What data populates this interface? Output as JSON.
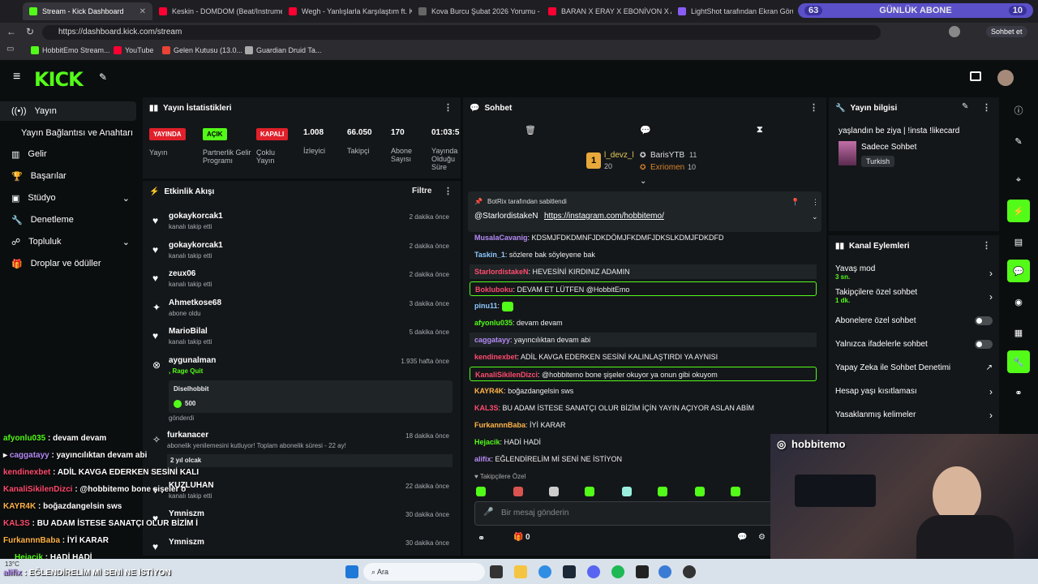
{
  "browser": {
    "tabs": [
      {
        "label": "Stream - Kick Dashboard",
        "color": "#53fc18"
      },
      {
        "label": "Keskin - DOMDOM (Beat/Instrume",
        "color": "#ff0033"
      },
      {
        "label": "Wegh - Yanlışlarla Karşılaştım ft. K",
        "color": "#ff0033"
      },
      {
        "label": "Kova Burcu Şubat 2026 Yorumu - ",
        "color": "#666666"
      },
      {
        "label": "BARAN X ERAY X EBONİVON X AY",
        "color": "#ff0033"
      },
      {
        "label": "LightShot tarafından Ekran Görün",
        "color": "#8a5cf6"
      }
    ],
    "url": "https://dashboard.kick.com/stream",
    "sub_counter": {
      "left": "63",
      "label": "GÜNLÜK ABONE",
      "right": "10"
    },
    "copilot": "Sohbet et",
    "bookmarks": [
      "HobbitEmo Stream...",
      "YouTube",
      "Gelen Kutusu (13.0...",
      "Guardian Druid Ta..."
    ]
  },
  "logo": "KICK",
  "sidebar": [
    {
      "label": "Yayın",
      "icon": "broadcast-icon"
    },
    {
      "label": "Yayın Bağlantısı ve Anahtarı",
      "icon": "none"
    },
    {
      "label": "Gelir",
      "icon": "chart-icon"
    },
    {
      "label": "Başarılar",
      "icon": "trophy-icon"
    },
    {
      "label": "Stüdyo",
      "icon": "studio-icon"
    },
    {
      "label": "Denetleme",
      "icon": "wrench-icon"
    },
    {
      "label": "Topluluk",
      "icon": "community-icon"
    },
    {
      "label": "Droplar ve ödüller",
      "icon": "gift-icon"
    }
  ],
  "stats": {
    "title": "Yayın İstatistikleri",
    "items": [
      {
        "badge": "YAYINDA",
        "badge_color": "#e0202a",
        "label": "Yayın"
      },
      {
        "badge": "AÇIK",
        "badge_color": "#53fc18",
        "label": "Partnerlik Gelir Programı"
      },
      {
        "badge": "KAPALI",
        "badge_color": "#e0202a",
        "label": "Çoklu Yayın"
      },
      {
        "value": "1.008",
        "label": "İzleyici"
      },
      {
        "value": "66.050",
        "label": "Takipçi"
      },
      {
        "value": "170",
        "label": "Abone Sayısı"
      },
      {
        "value": "01:03:5",
        "label": "Yayında Olduğu Süre"
      }
    ]
  },
  "activity": {
    "title": "Etkinlik Akışı",
    "filter": "Filtre",
    "items": [
      {
        "name": "gokaykorcak1",
        "desc": "kanalı takip etti",
        "time": "2 dakika önce"
      },
      {
        "name": "gokaykorcak1",
        "desc": "kanalı takip etti",
        "time": "2 dakika önce"
      },
      {
        "name": "zeux06",
        "desc": "kanalı takip etti",
        "time": "2 dakika önce"
      },
      {
        "name": "Ahmetkose68",
        "desc": "abone oldu",
        "time": "3 dakika önce"
      },
      {
        "name": "MarioBilal",
        "desc": "kanalı takip etti",
        "time": "5 dakika önce"
      },
      {
        "name": "aygunalman",
        "desc": ", Rage Quit",
        "time": "1.935 hafta önce"
      }
    ],
    "gift": {
      "user": "Diselhobbit",
      "amount": "500",
      "sent": "gönderdi"
    },
    "item7": {
      "name": "furkanacer",
      "desc": "abonelik yenilemesini kutluyor! Toplam abonelik süresi - 22 ay!",
      "note": "2 yıl olcak",
      "time": "18 dakika önce"
    },
    "item8": {
      "name": "KUZLUHAN",
      "desc": "kanalı takip etti",
      "time": "22 dakika önce"
    },
    "item9": {
      "name": "Ymniszm",
      "time": "30 dakika önce"
    },
    "item10": {
      "name": "Ymniszm",
      "time": "30 dakika önce"
    }
  },
  "chat": {
    "title": "Sohbet",
    "top": [
      {
        "name": "l_devz_l",
        "count": "20"
      },
      {
        "name": "BarisYTB",
        "count": "11"
      },
      {
        "name": "Exriomen",
        "count": "10"
      }
    ],
    "top_rank": "1",
    "pinned_by": "BotRix tarafından sabitlendi",
    "pinned_text": "@StarlordistakeN",
    "pinned_link": "https://instagram.com/hobbitemo/",
    "messages": [
      {
        "user": "MusalaCavanig",
        "color": "#b48af5",
        "text": "KDSMJFDKDMNFJDKDÖMJFKDMFJDKSLKDMJFDKDFD",
        "style": ""
      },
      {
        "user": "Taskin_1",
        "color": "#8ec9ff",
        "text": "sözlere bak söyleyene bak",
        "style": ""
      },
      {
        "user": "StarlordistakeN",
        "color": "#ff4b6e",
        "text": "HEVESİNİ KIRDINIZ ADAMIN",
        "style": "pur"
      },
      {
        "user": "Bokluboku",
        "color": "#ff4b6e",
        "text": "DEVAM ET LÜTFEN @HobbitEmo",
        "style": "hl"
      },
      {
        "user": "pinu11",
        "color": "#8ec9ff",
        "text": "",
        "style": ""
      },
      {
        "user": "afyonlu035",
        "color": "#53fc18",
        "text": "devam devam",
        "style": ""
      },
      {
        "user": "caggatayy",
        "color": "#b48af5",
        "text": "yayıncılıktan devam abi",
        "style": "pur"
      },
      {
        "user": "kendinexbet",
        "color": "#ff4b6e",
        "text": "ADİL KAVGA EDERKEN SESİNİ KALINLAŞTIRDI YA AYNISI",
        "style": ""
      },
      {
        "user": "KanaliSikilenDizci",
        "color": "#ff4b6e",
        "text": "@hobbitemo bone şişeler okuyor ya onun gibi okuyom",
        "style": "hl"
      },
      {
        "user": "KAYR4K",
        "color": "#ffb347",
        "text": "boğazdangelsin sws",
        "style": ""
      },
      {
        "user": "KAL3S",
        "color": "#ff4b6e",
        "text": "BU ADAM İSTESE SANATÇI OLUR BİZİM İÇİN YAYIN AÇIYOR ASLAN ABİM",
        "style": ""
      },
      {
        "user": "FurkannnBaba",
        "color": "#ffb347",
        "text": "İYİ KARAR",
        "style": ""
      },
      {
        "user": "Hejacik",
        "color": "#53fc18",
        "text": "HADİ HADİ",
        "style": ""
      },
      {
        "user": "alifix",
        "color": "#b48af5",
        "text": "EĞLENDİRELİM Mİ SENİ NE İSTİYON",
        "style": ""
      }
    ],
    "followers_label": "Takipçilere Özel",
    "placeholder": "Bir mesaj gönderin",
    "count": "0"
  },
  "info": {
    "title": "Yayın bilgisi",
    "stream_title": "yaşlandın be ziya | !insta !likecard",
    "category": "Sadece Sohbet",
    "language": "Turkish"
  },
  "actions": {
    "title": "Kanal Eylemleri",
    "items": [
      {
        "label": "Yavaş mod",
        "sub": "3 sn.",
        "control": "chevron"
      },
      {
        "label": "Takipçilere özel sohbet",
        "sub": "1 dk.",
        "control": "chevron"
      },
      {
        "label": "Abonelere özel sohbet",
        "sub": "",
        "control": "toggle"
      },
      {
        "label": "Yalnızca ifadelerle sohbet",
        "sub": "",
        "control": "toggle"
      },
      {
        "label": "Yapay Zeka ile Sohbet Denetimi",
        "sub": "",
        "control": "external"
      },
      {
        "label": "Hesap yaşı kısıtlaması",
        "sub": "",
        "control": "chevron"
      },
      {
        "label": "Yasaklanmış kelimeler",
        "sub": "",
        "control": "chevron"
      }
    ]
  },
  "overlay": {
    "cam_name": "hobbitemo",
    "lines": [
      {
        "user": "afyonlu035",
        "text": "devam devam",
        "color": "#53fc18"
      },
      {
        "user": "caggatayy",
        "text": "yayıncılıktan devam abi",
        "color": "#b48af5"
      },
      {
        "user": "kendinexbet",
        "text": "ADİL KAVGA EDERKEN SESİNİ KALI",
        "color": "#ff4b6e"
      },
      {
        "user": "KanaliSikilenDizci",
        "text": "@hobbitemo bone şişeler o",
        "color": "#ff4b6e"
      },
      {
        "user": "KAYR4K",
        "text": "boğazdangelsin sws",
        "color": "#ffb347"
      },
      {
        "user": "KAL3S",
        "text": "BU ADAM İSTESE SANATÇI OLUR BİZİM İ",
        "color": "#ff4b6e"
      },
      {
        "user": "FurkannnBaba",
        "text": "İYİ KARAR",
        "color": "#ffb347"
      },
      {
        "user": "Hejacik",
        "text": "HADİ HADİ",
        "color": "#53fc18"
      },
      {
        "user": "alifix",
        "text": "EĞLENDİRELİM Mİ SENİ NE İSTİYON",
        "color": "#b48af5"
      }
    ]
  },
  "taskbar": {
    "search": "Ara",
    "weather": "13°C"
  }
}
